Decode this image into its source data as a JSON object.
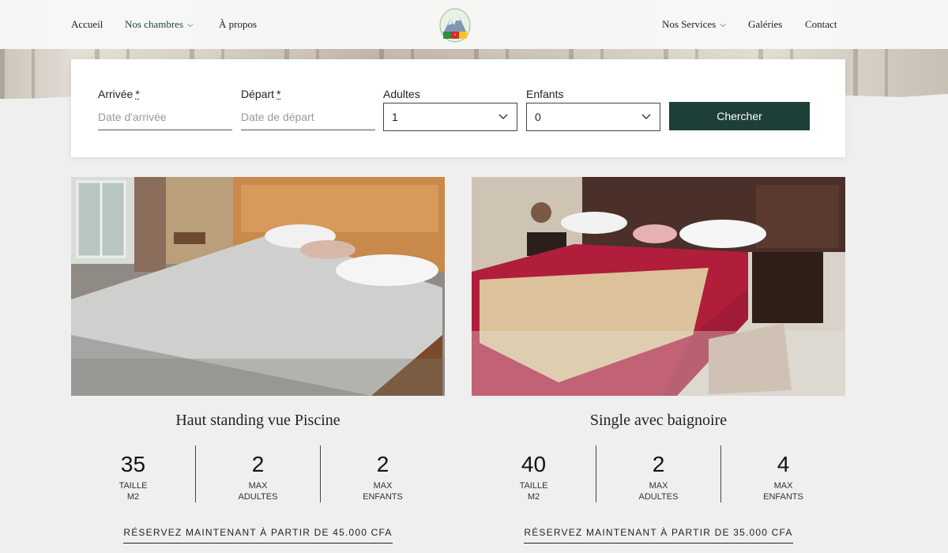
{
  "nav": {
    "left": [
      {
        "label": "Accueil"
      },
      {
        "label": "Nos chambres",
        "dropdown": true
      },
      {
        "label": "À propos"
      }
    ],
    "right": [
      {
        "label": "Nos Services",
        "dropdown": true
      },
      {
        "label": "Galéries"
      },
      {
        "label": "Contact"
      }
    ],
    "chevron": "⌵",
    "logo_icon": "mountain-flag-logo"
  },
  "search": {
    "arrival_label": "Arrivée",
    "arrival_placeholder": "Date d'arrivée",
    "departure_label": "Départ",
    "departure_placeholder": "Date de départ",
    "required_mark": "*",
    "adults_label": "Adultes",
    "adults_value": "1",
    "children_label": "Enfants",
    "children_value": "0",
    "button_label": "Chercher",
    "button_color": "#1e3f37"
  },
  "rooms": [
    {
      "title": "Haut standing vue Piscine",
      "stats": [
        {
          "value": "35",
          "label1": "TAILLE",
          "label2": "M2"
        },
        {
          "value": "2",
          "label1": "MAX",
          "label2": "ADULTES"
        },
        {
          "value": "2",
          "label1": "MAX",
          "label2": "ENFANTS"
        }
      ],
      "reserve": "RÉSERVEZ MAINTENANT À PARTIR DE  45.000 CFA"
    },
    {
      "title": "Single avec baignoire",
      "stats": [
        {
          "value": "40",
          "label1": "TAILLE",
          "label2": "M2"
        },
        {
          "value": "2",
          "label1": "MAX",
          "label2": "ADULTES"
        },
        {
          "value": "4",
          "label1": "MAX",
          "label2": "ENFANTS"
        }
      ],
      "reserve": "RÉSERVEZ MAINTENANT À PARTIR DE  35.000 CFA"
    }
  ]
}
